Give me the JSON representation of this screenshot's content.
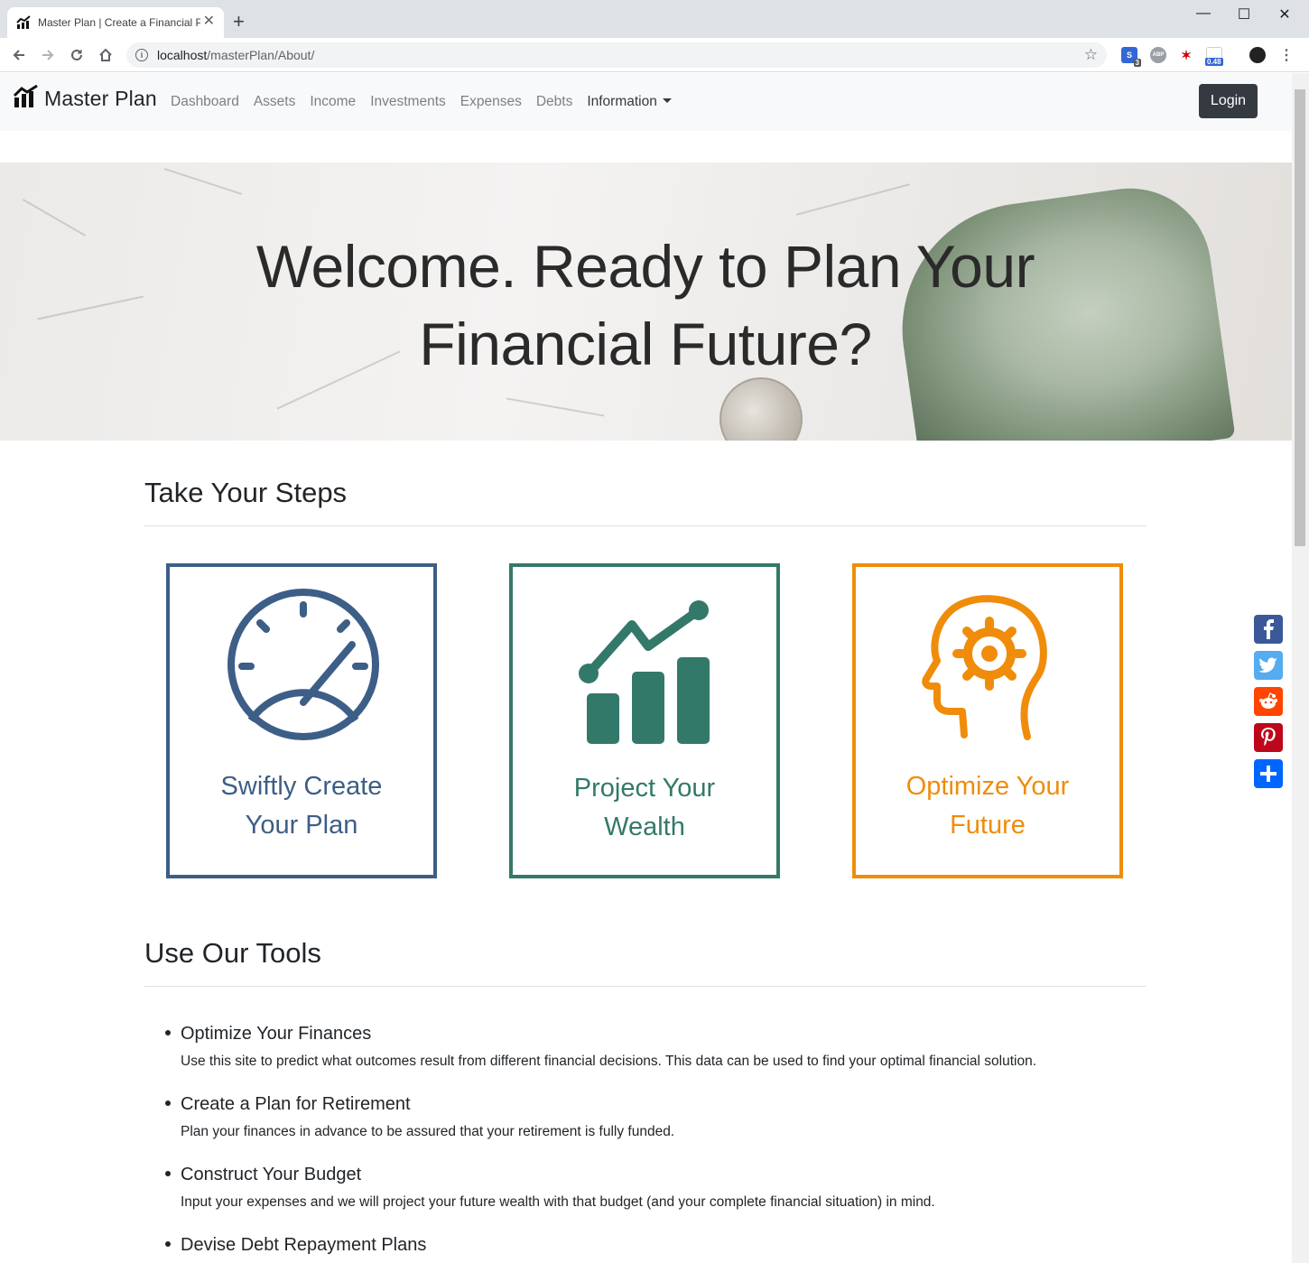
{
  "browser": {
    "tab_title": "Master Plan | Create a Financial P",
    "url_host": "localhost",
    "url_path": "/masterPlan/About/",
    "ext_badge_count": "3",
    "ext_speed": "0.48",
    "ext_abp": "ABP"
  },
  "navbar": {
    "brand": "Master Plan",
    "links": [
      "Dashboard",
      "Assets",
      "Income",
      "Investments",
      "Expenses",
      "Debts"
    ],
    "dropdown": "Information",
    "login": "Login"
  },
  "hero": {
    "line1": "Welcome. Ready to Plan Your",
    "line2": "Financial Future?"
  },
  "steps": {
    "title": "Take Your Steps",
    "cards": [
      {
        "line1": "Swiftly Create",
        "line2": "Your Plan",
        "color": "#3d5e86"
      },
      {
        "line1": "Project Your",
        "line2": "Wealth",
        "color": "#33796a"
      },
      {
        "line1": "Optimize Your",
        "line2": "Future",
        "color": "#f08c0a"
      }
    ]
  },
  "tools": {
    "title": "Use Our Tools",
    "items": [
      {
        "title": "Optimize Your Finances",
        "desc": "Use this site to predict what outcomes result from different financial decisions. This data can be used to find your optimal financial solution."
      },
      {
        "title": "Create a Plan for Retirement",
        "desc": "Plan your finances in advance to be assured that your retirement is fully funded."
      },
      {
        "title": "Construct Your Budget",
        "desc": "Input your expenses and we will project your future wealth with that budget (and your complete financial situation) in mind."
      },
      {
        "title": "Devise Debt Repayment Plans",
        "desc": ""
      }
    ]
  },
  "share": {
    "icons": [
      "facebook-icon",
      "twitter-icon",
      "reddit-icon",
      "pinterest-icon",
      "share-plus-icon"
    ],
    "colors": [
      "#3b5998",
      "#55acee",
      "#ff4500",
      "#bd081c",
      "#0166ff"
    ]
  }
}
